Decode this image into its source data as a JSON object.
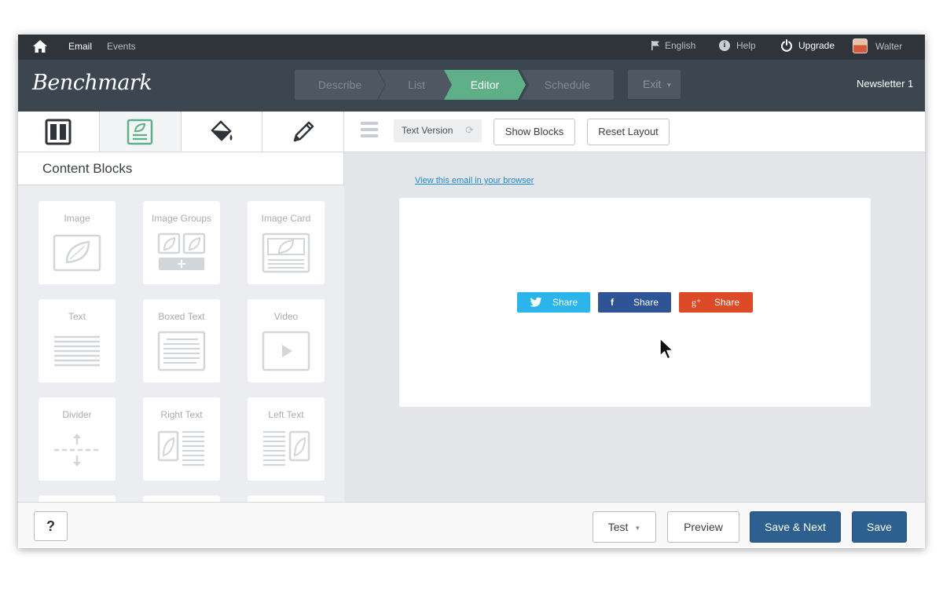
{
  "topbar": {
    "nav": [
      {
        "label": "Email",
        "active": true
      },
      {
        "label": "Events",
        "active": false
      }
    ],
    "language": "English",
    "help": "Help",
    "upgrade": "Upgrade",
    "user": "Walter"
  },
  "header": {
    "logo": "Benchmark",
    "steps": [
      {
        "label": "Describe",
        "active": false
      },
      {
        "label": "List",
        "active": false
      },
      {
        "label": "Editor",
        "active": true
      },
      {
        "label": "Schedule",
        "active": false
      }
    ],
    "exit": "Exit",
    "newsletter": "Newsletter 1"
  },
  "sidebar": {
    "tabs": [
      "layout-icon",
      "content-icon",
      "paint-bucket-icon",
      "pencil-icon"
    ],
    "title": "Content Blocks",
    "blocks": [
      {
        "label": "Image"
      },
      {
        "label": "Image Groups"
      },
      {
        "label": "Image Card"
      },
      {
        "label": "Text"
      },
      {
        "label": "Boxed Text"
      },
      {
        "label": "Video"
      },
      {
        "label": "Divider"
      },
      {
        "label": "Right Text"
      },
      {
        "label": "Left Text"
      }
    ]
  },
  "toolbar": {
    "text_version": "Text Version",
    "show_blocks": "Show Blocks",
    "reset_layout": "Reset Layout"
  },
  "email": {
    "view_link": "View this email in your browser",
    "shares": [
      {
        "network": "twitter",
        "icon": "twitter-icon",
        "label": "Share",
        "color": "#2cb5ea"
      },
      {
        "network": "facebook",
        "icon": "facebook-icon",
        "label": "Share",
        "color": "#2f5496"
      },
      {
        "network": "googleplus",
        "icon": "google-plus-icon",
        "label": "Share",
        "color": "#dc4a28"
      }
    ]
  },
  "footer": {
    "help": "?",
    "test": "Test",
    "preview": "Preview",
    "save_next": "Save & Next",
    "save": "Save"
  },
  "colors": {
    "accent_green": "#5fb089",
    "primary_blue": "#2d5f8f",
    "header_bg": "#3c4650",
    "topbar_bg": "#2f343b"
  }
}
